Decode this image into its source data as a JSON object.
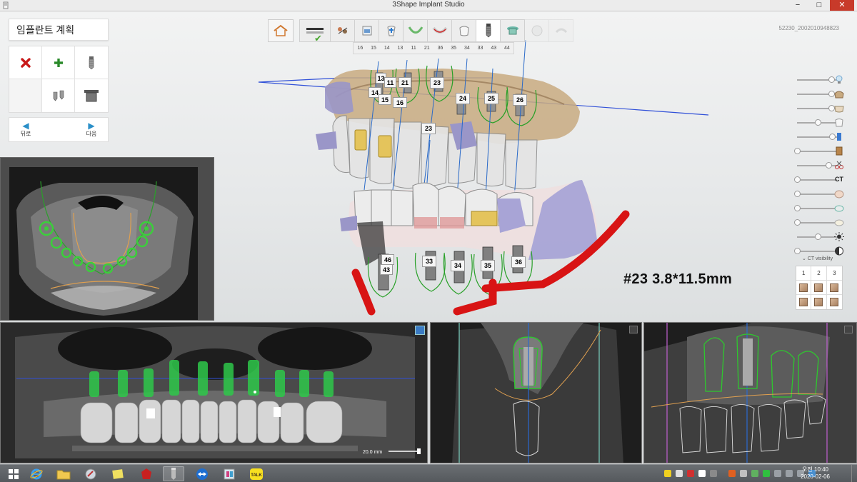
{
  "window": {
    "title": "3Shape Implant Studio",
    "minimize": "−",
    "maximize": "□",
    "close": "✕"
  },
  "left_panel": {
    "title": "임플란트 계획",
    "tools": [
      {
        "name": "delete-implant",
        "icon": "red-x-icon"
      },
      {
        "name": "add-implant",
        "icon": "green-plus-icon"
      },
      {
        "name": "implant-library",
        "icon": "implant-icon"
      },
      {
        "name": "empty",
        "icon": ""
      },
      {
        "name": "multi-implant",
        "icon": "implant-pair-icon"
      },
      {
        "name": "sleeve",
        "icon": "sleeve-icon"
      }
    ],
    "back_label": "뒤로",
    "next_label": "다음"
  },
  "workflow": {
    "steps": [
      "scan-import",
      "segmentation",
      "ct-data",
      "alignment",
      "jaw-curve",
      "nerve",
      "crown",
      "implant",
      "guide",
      "finish",
      "export"
    ],
    "active_step": "implant"
  },
  "tooth_strip": [
    "16",
    "15",
    "14",
    "13",
    "11",
    "21",
    "36",
    "35",
    "34",
    "33",
    "43",
    "44"
  ],
  "case_id": "52230_2002010948823",
  "implant_labels_upper": [
    "13",
    "11",
    "21",
    "23",
    "24",
    "25",
    "26",
    "14",
    "15",
    "16",
    "23"
  ],
  "implant_labels_lower": [
    "46",
    "43",
    "33",
    "34",
    "35",
    "36"
  ],
  "implant_info": "#23  3.8*11.5mm",
  "sliders": [
    {
      "icon": "bulb-icon",
      "level": 0.92
    },
    {
      "icon": "upper-model-icon",
      "level": 0.92
    },
    {
      "icon": "lower-model-icon",
      "level": 0.92
    },
    {
      "icon": "tooth-icon",
      "level": 0.55
    },
    {
      "icon": "implant-blue-icon",
      "level": 0.95
    },
    {
      "icon": "sleeve-brown-icon",
      "level": 0.0
    },
    {
      "icon": "scissors-icon",
      "level": 0.85
    },
    {
      "icon": "ct-label",
      "text": "CT",
      "level": 0.0
    },
    {
      "icon": "bone-icon",
      "level": 0.0
    },
    {
      "icon": "nerve-icon",
      "level": 0.0
    },
    {
      "icon": "gingiva-icon",
      "level": 0.0
    },
    {
      "icon": "brightness-icon",
      "level": 0.55
    },
    {
      "icon": "contrast-icon",
      "level": 0.0
    }
  ],
  "ct_visibility": "CT visibility",
  "view_tabs": [
    "1",
    "2",
    "3"
  ],
  "scale_bar": "20.0 mm",
  "clock": {
    "time": "오전 10:40",
    "date": "2020-02-06"
  },
  "taskbar": [
    "start",
    "internet-explorer",
    "file-explorer",
    "control-panel",
    "sticky-notes",
    "3shape-red",
    "implant-studio",
    "teamviewer",
    "image-app",
    "kakaotalk"
  ],
  "kakaotalk_label": "TALK"
}
